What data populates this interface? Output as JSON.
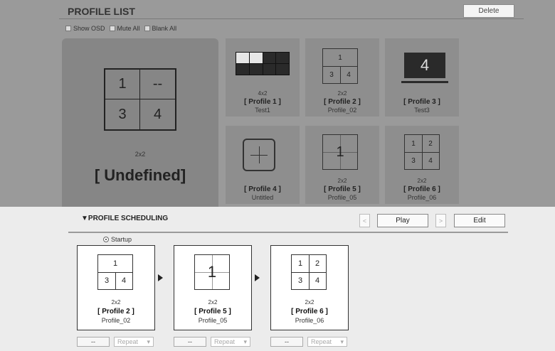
{
  "header": {
    "title": "PROFILE LIST",
    "delete_label": "Delete"
  },
  "options": [
    {
      "label": "Show OSD",
      "checked": false
    },
    {
      "label": "Mute All",
      "checked": false
    },
    {
      "label": "Blank All",
      "checked": false
    }
  ],
  "selected_profile": {
    "cells": [
      "1",
      "--",
      "3",
      "4"
    ],
    "size": "2x2",
    "name": "[ Undefined]"
  },
  "profiles": [
    {
      "size": "4x2",
      "name": "[ Profile 1 ]",
      "subtitle": "Test1"
    },
    {
      "size": "2x2",
      "name": "[ Profile 2 ]",
      "subtitle": "Profile_02",
      "cells": [
        "1",
        "3",
        "4"
      ]
    },
    {
      "size": "",
      "name": "[ Profile 3 ]",
      "subtitle": "Test3",
      "display_number": "4"
    },
    {
      "size": "",
      "name": "[ Profile 4 ]",
      "subtitle": "Untitled"
    },
    {
      "size": "2x2",
      "name": "[ Profile 5 ]",
      "subtitle": "Profile_05",
      "cells": [
        "1"
      ]
    },
    {
      "size": "2x2",
      "name": "[ Profile 6 ]",
      "subtitle": "Profile_06",
      "cells": [
        "1",
        "2",
        "3",
        "4"
      ]
    }
  ],
  "scheduling": {
    "title": "▼PROFILE SCHEDULING",
    "prev_label": "<",
    "play_label": "Play",
    "next_label": ">",
    "edit_label": "Edit",
    "startup_label": "Startup",
    "items": [
      {
        "size": "2x2",
        "name": "[ Profile 2 ]",
        "subtitle": "Profile_02",
        "cells": [
          "1",
          "3",
          "4"
        ],
        "duration": "--",
        "repeat": "Repeat"
      },
      {
        "size": "2x2",
        "name": "[ Profile 5 ]",
        "subtitle": "Profile_05",
        "cells": [
          "1"
        ],
        "duration": "--",
        "repeat": "Repeat"
      },
      {
        "size": "2x2",
        "name": "[ Profile 6 ]",
        "subtitle": "Profile_06",
        "cells": [
          "1",
          "2",
          "3",
          "4"
        ],
        "duration": "--",
        "repeat": "Repeat"
      }
    ]
  }
}
